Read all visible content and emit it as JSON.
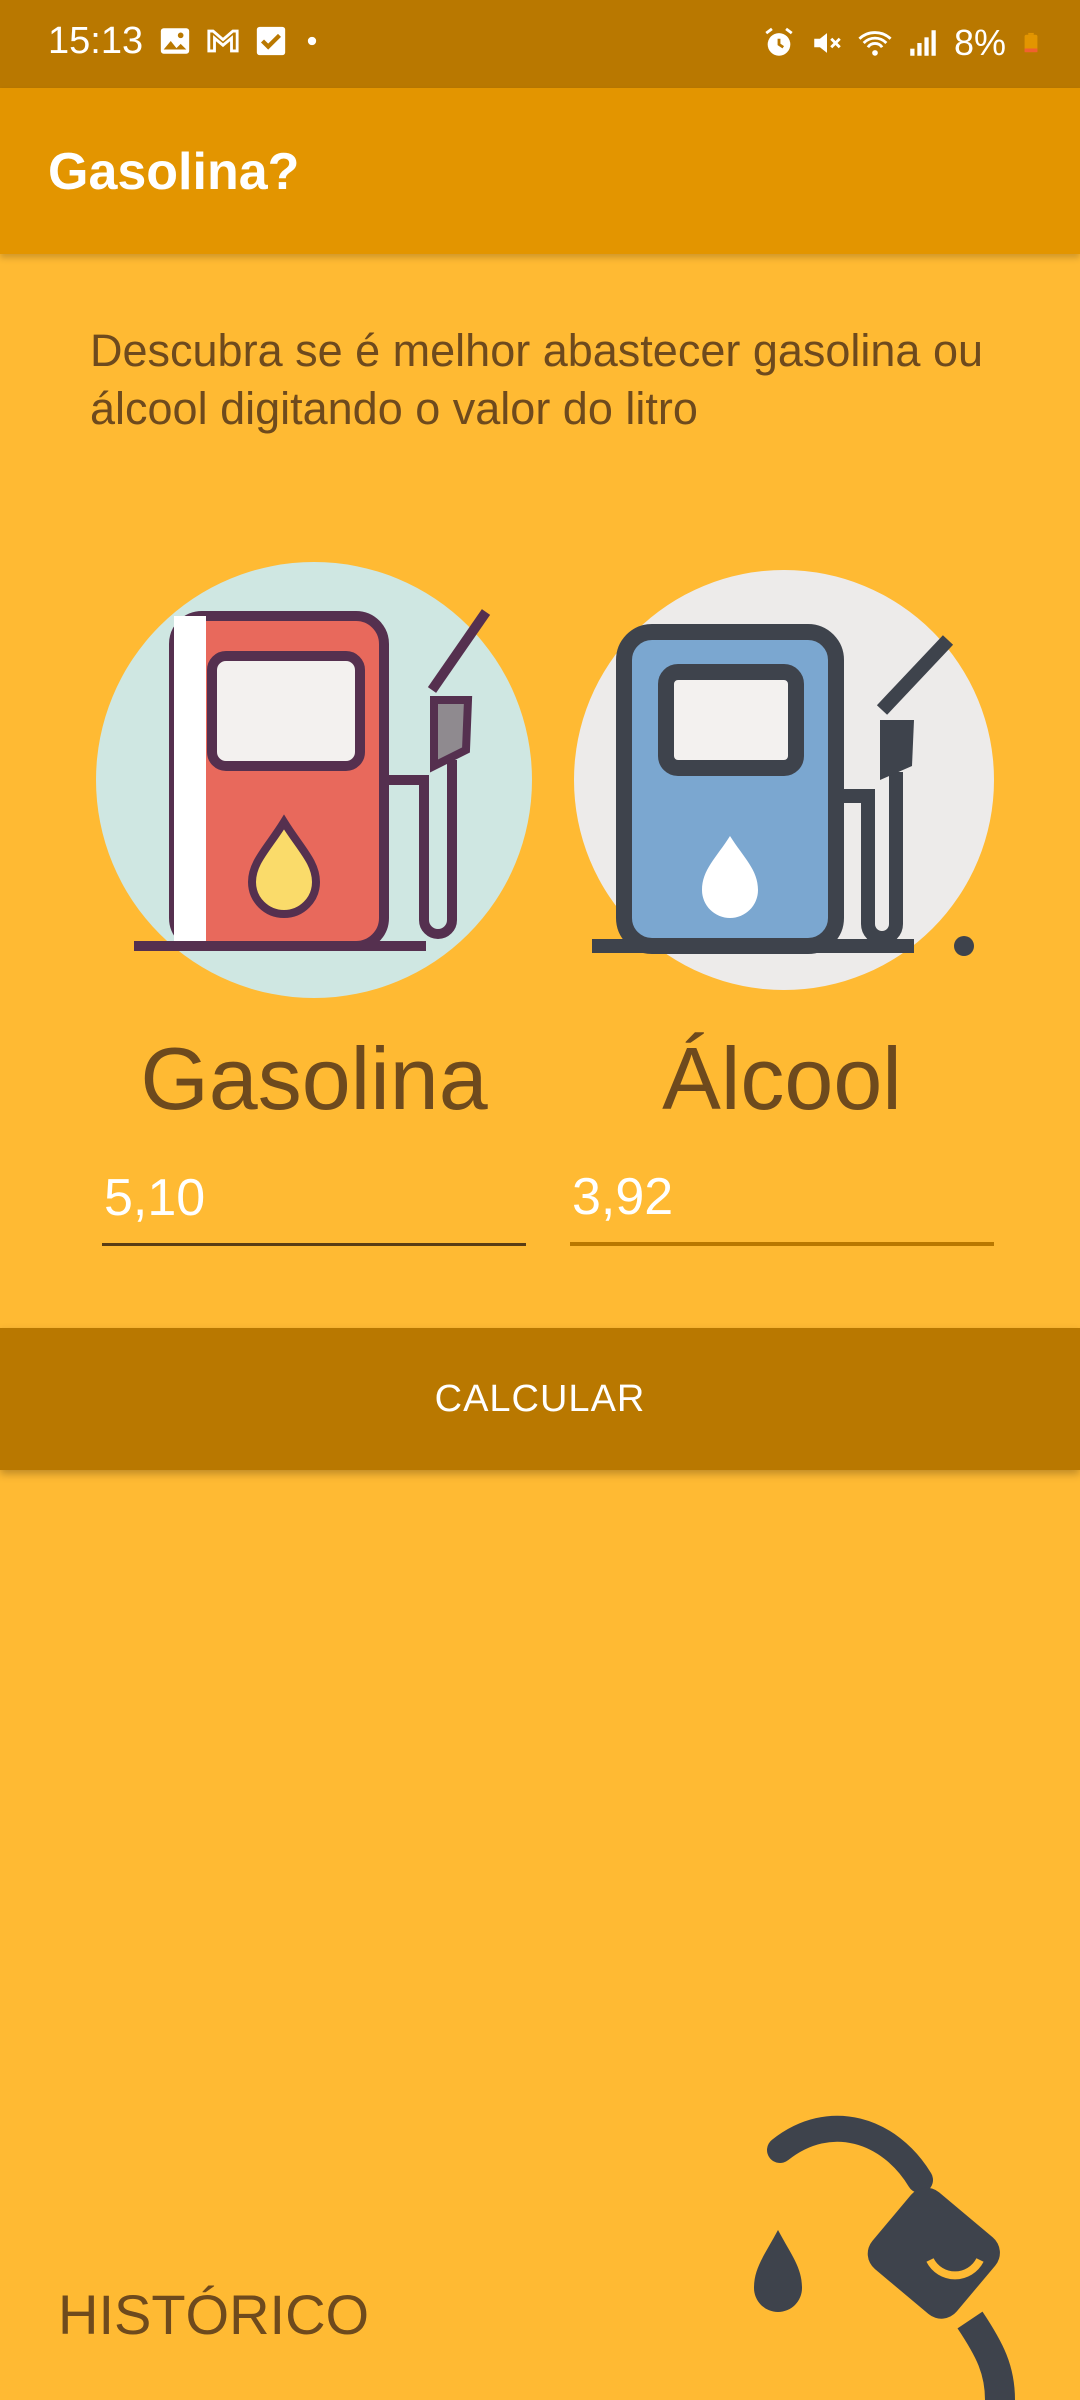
{
  "status_bar": {
    "time": "15:13",
    "battery": "8%",
    "left_icons": [
      "image-icon",
      "gmail-icon",
      "check-box-icon",
      "dot-icon"
    ],
    "right_icons": [
      "alarm-icon",
      "mute-icon",
      "wifi-icon",
      "signal-icon",
      "battery-icon"
    ]
  },
  "app_bar": {
    "title": "Gasolina?"
  },
  "intro": {
    "text": "Descubra se é melhor abastecer gasolina ou álcool digitando o valor do litro"
  },
  "gasolina": {
    "label": "Gasolina",
    "value": "5,10",
    "icon": "gas-pump-icon",
    "pump_color": "#E8695C"
  },
  "alcool": {
    "label": "Álcool",
    "value": "3,92",
    "icon": "gas-pump-icon",
    "pump_color": "#7BA7D0"
  },
  "calculate_button": {
    "label": "CALCULAR"
  },
  "history": {
    "label": "HISTÓRICO",
    "icon": "fuel-nozzle-icon"
  },
  "colors": {
    "background": "#FFBA33",
    "status_bar": "#B97800",
    "app_bar": "#E39500",
    "button": "#B97800",
    "text_brown": "#6E4A1D"
  }
}
